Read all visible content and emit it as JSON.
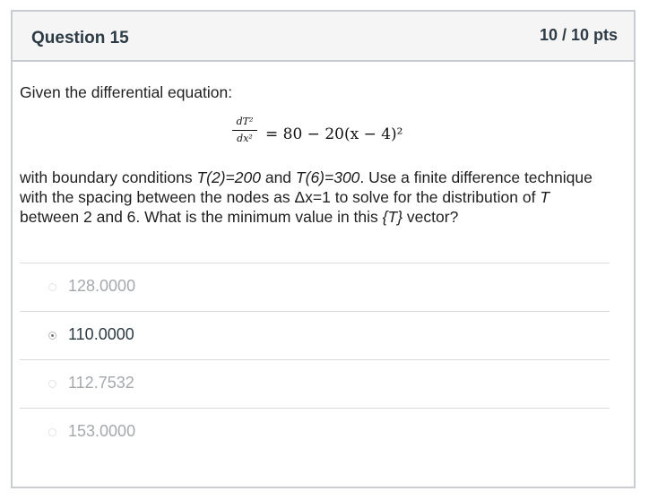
{
  "question": {
    "title": "Question 15",
    "points": "10 / 10 pts",
    "intro": "Given the differential equation:",
    "equation": {
      "numerator": "dT²",
      "denominator": "dx²",
      "rhs": "= 80 − 20(x − 4)²"
    },
    "text_parts": {
      "p1": "with boundary conditions ",
      "bc1": "T(2)=200",
      "p2": " and ",
      "bc2": "T(6)=300",
      "p3": ". Use a finite difference technique with the spacing between the nodes as Δx=1 to solve for the distribution of ",
      "var_T": "T",
      "p4": " between 2 and 6. What is the minimum value in this ",
      "vec": "{T}",
      "p5": " vector?"
    }
  },
  "answers": [
    {
      "label": "128.0000",
      "selected": false
    },
    {
      "label": "110.0000",
      "selected": true
    },
    {
      "label": "112.7532",
      "selected": false
    },
    {
      "label": "153.0000",
      "selected": false
    }
  ]
}
